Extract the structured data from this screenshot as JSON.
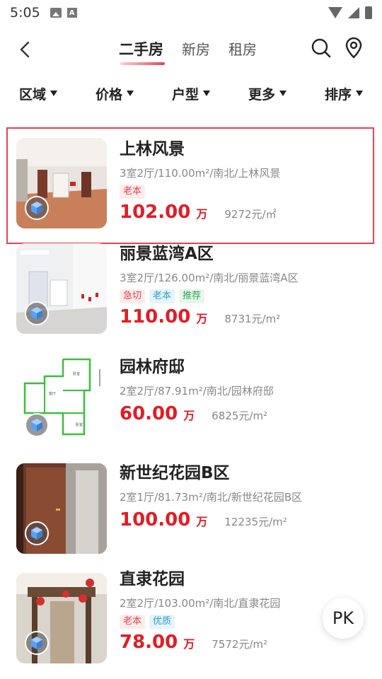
{
  "status": {
    "time": "5:05"
  },
  "nav": {
    "tabs": [
      {
        "label": "二手房"
      },
      {
        "label": "新房"
      },
      {
        "label": "租房"
      }
    ]
  },
  "filters": [
    {
      "label": "区域"
    },
    {
      "label": "价格"
    },
    {
      "label": "户型"
    },
    {
      "label": "更多"
    },
    {
      "label": "排序"
    }
  ],
  "listings": [
    {
      "title": "上林风景",
      "specs": "3室2厅/110.00m²/南北/上林风景",
      "tags": [
        "老本"
      ],
      "price": "102.00",
      "price_unit": "万",
      "unit_price": "9272元/㎡"
    },
    {
      "title": "丽景蓝湾A区",
      "specs": "3室2厅/126.00m²/南北/丽景蓝湾A区",
      "tags": [
        "急切",
        "老本",
        "推荐"
      ],
      "price": "110.00",
      "price_unit": "万",
      "unit_price": "8731元/m²"
    },
    {
      "title": "园林府邸",
      "specs": "2室2厅/87.91m²/南北/园林府邸",
      "tags": [],
      "price": "60.00",
      "price_unit": "万",
      "unit_price": "6825元/m²"
    },
    {
      "title": "新世纪花园B区",
      "specs": "2室1厅/81.73m²/南北/新世纪花园B区",
      "tags": [],
      "price": "100.00",
      "price_unit": "万",
      "unit_price": "12235元/m²"
    },
    {
      "title": "直隶花园",
      "specs": "2室2厅/103.00m²/南北/直隶花园",
      "tags": [
        "老本",
        "优质"
      ],
      "price": "78.00",
      "price_unit": "万",
      "unit_price": "7572元/m²"
    }
  ],
  "pk_label": "PK",
  "colors": {
    "accent": "#e31c25",
    "selection": "#e8424f"
  }
}
